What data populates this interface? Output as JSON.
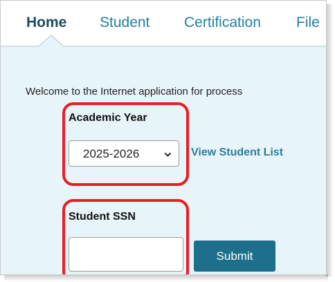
{
  "tabs": {
    "home": "Home",
    "student": "Student",
    "certification": "Certification",
    "file": "File"
  },
  "main": {
    "welcome": "Welcome to the Internet application for process",
    "academic_year_label": "Academic Year",
    "academic_year_selected": "2025-2026",
    "view_student_list": "View Student List",
    "student_ssn_label": "Student SSN",
    "student_ssn_value": "",
    "submit_label": "Submit"
  },
  "colors": {
    "tab_link": "#1f7f9e",
    "tab_active": "#1d4a5e",
    "content_bg": "#e7f4fa",
    "submit_bg": "#1d6f8c",
    "highlight": "#ea1c24"
  },
  "icons": {
    "select_chevron": "chevron-down-icon"
  }
}
